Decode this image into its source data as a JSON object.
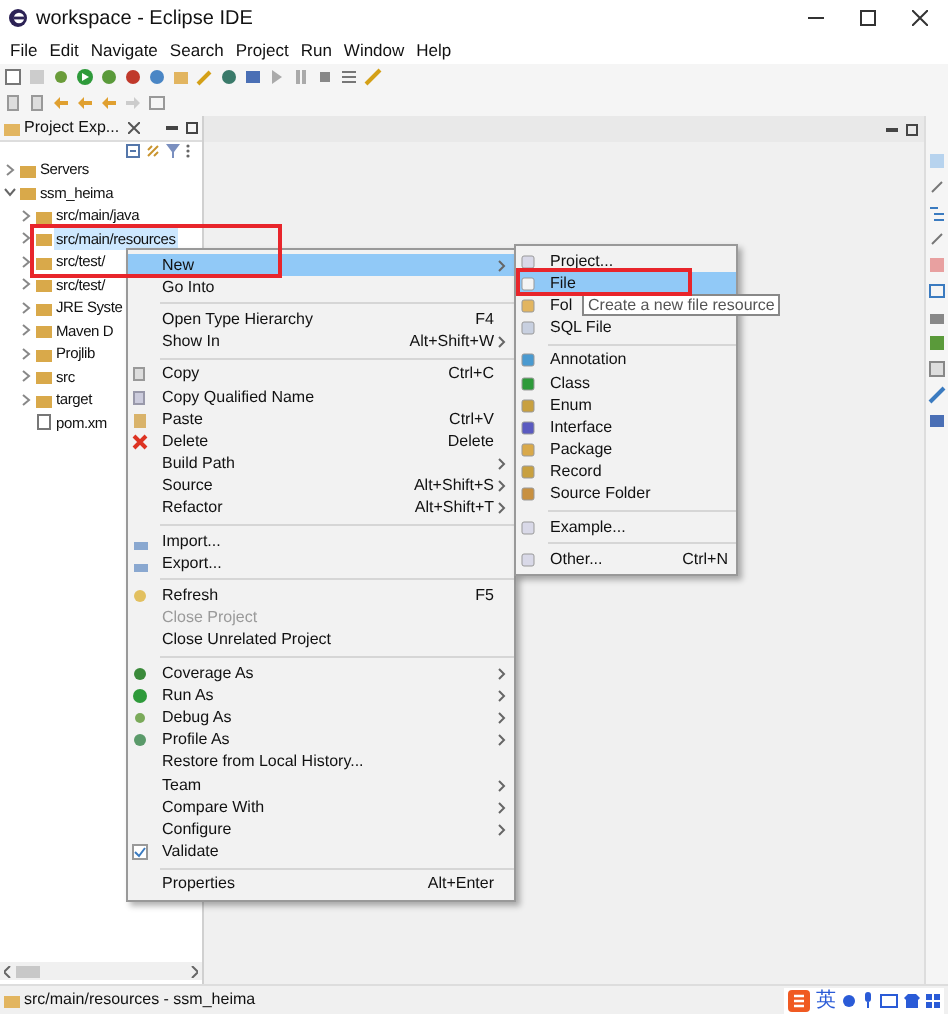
{
  "window": {
    "title": "workspace - Eclipse IDE"
  },
  "menu_bar": [
    "File",
    "Edit",
    "Navigate",
    "Search",
    "Project",
    "Run",
    "Window",
    "Help"
  ],
  "project_explorer": {
    "title": "Project Exp...",
    "tree": [
      {
        "label": "Servers",
        "expanded": false,
        "selected": false
      },
      {
        "label": "ssm_heima",
        "expanded": true,
        "selected": false,
        "children": [
          {
            "label": "src/main/java",
            "expanded": false,
            "selected": false
          },
          {
            "label": "src/main/resources",
            "expanded": false,
            "selected": true
          },
          {
            "label": "src/test/",
            "expanded": false,
            "selected": false
          },
          {
            "label": "src/test/",
            "expanded": false,
            "selected": false
          },
          {
            "label": "JRE Syste",
            "expanded": false,
            "selected": false
          },
          {
            "label": "Maven D",
            "expanded": false,
            "selected": false
          },
          {
            "label": "Projlib",
            "expanded": false,
            "selected": false
          },
          {
            "label": "src",
            "expanded": false,
            "selected": false
          },
          {
            "label": "target",
            "expanded": false,
            "selected": false
          },
          {
            "label": "pom.xm",
            "selected": false
          }
        ]
      }
    ]
  },
  "context_menu": [
    {
      "kind": "item",
      "label": "New",
      "submenu": true,
      "selected": true
    },
    {
      "kind": "item",
      "label": "Go Into",
      "selected": false
    },
    {
      "kind": "separator"
    },
    {
      "kind": "item",
      "label": "Open Type Hierarchy",
      "shortcut": "F4",
      "selected": false
    },
    {
      "kind": "item",
      "label": "Show In",
      "shortcut": "Alt+Shift+W",
      "submenu": true,
      "selected": false
    },
    {
      "kind": "separator"
    },
    {
      "kind": "item",
      "label": "Copy",
      "shortcut": "Ctrl+C",
      "selected": false
    },
    {
      "kind": "item",
      "label": "Copy Qualified Name",
      "selected": false
    },
    {
      "kind": "item",
      "label": "Paste",
      "shortcut": "Ctrl+V",
      "selected": false
    },
    {
      "kind": "item",
      "label": "Delete",
      "shortcut": "Delete",
      "selected": false
    },
    {
      "kind": "item",
      "label": "Build Path",
      "submenu": true,
      "selected": false
    },
    {
      "kind": "item",
      "label": "Source",
      "shortcut": "Alt+Shift+S",
      "submenu": true,
      "selected": false
    },
    {
      "kind": "item",
      "label": "Refactor",
      "shortcut": "Alt+Shift+T",
      "submenu": true,
      "selected": false
    },
    {
      "kind": "separator"
    },
    {
      "kind": "item",
      "label": "Import...",
      "selected": false
    },
    {
      "kind": "item",
      "label": "Export...",
      "selected": false
    },
    {
      "kind": "separator"
    },
    {
      "kind": "item",
      "label": "Refresh",
      "shortcut": "F5",
      "selected": false
    },
    {
      "kind": "item",
      "label": "Close Project",
      "disabled": true,
      "selected": false
    },
    {
      "kind": "item",
      "label": "Close Unrelated Project",
      "selected": false
    },
    {
      "kind": "separator"
    },
    {
      "kind": "item",
      "label": "Coverage As",
      "submenu": true,
      "selected": false
    },
    {
      "kind": "item",
      "label": "Run As",
      "submenu": true,
      "selected": false
    },
    {
      "kind": "item",
      "label": "Debug As",
      "submenu": true,
      "selected": false
    },
    {
      "kind": "item",
      "label": "Profile As",
      "submenu": true,
      "selected": false
    },
    {
      "kind": "item",
      "label": "Restore from Local History...",
      "selected": false
    },
    {
      "kind": "item",
      "label": "Team",
      "submenu": true,
      "selected": false
    },
    {
      "kind": "item",
      "label": "Compare With",
      "submenu": true,
      "selected": false
    },
    {
      "kind": "item",
      "label": "Configure",
      "submenu": true,
      "selected": false
    },
    {
      "kind": "check",
      "label": "Validate",
      "checked": true,
      "selected": false
    },
    {
      "kind": "separator"
    },
    {
      "kind": "item",
      "label": "Properties",
      "shortcut": "Alt+Enter",
      "selected": false
    }
  ],
  "new_submenu": [
    {
      "kind": "item",
      "label": "Project...",
      "selected": false
    },
    {
      "kind": "item",
      "label": "File",
      "selected": true
    },
    {
      "kind": "item",
      "label": "Fol",
      "selected": false
    },
    {
      "kind": "item",
      "label": "SQL File",
      "selected": false
    },
    {
      "kind": "separator"
    },
    {
      "kind": "item",
      "label": "Annotation",
      "selected": false
    },
    {
      "kind": "item",
      "label": "Class",
      "selected": false
    },
    {
      "kind": "item",
      "label": "Enum",
      "selected": false
    },
    {
      "kind": "item",
      "label": "Interface",
      "selected": false
    },
    {
      "kind": "item",
      "label": "Package",
      "selected": false
    },
    {
      "kind": "item",
      "label": "Record",
      "selected": false
    },
    {
      "kind": "item",
      "label": "Source Folder",
      "selected": false
    },
    {
      "kind": "separator"
    },
    {
      "kind": "item",
      "label": "Example...",
      "selected": false
    },
    {
      "kind": "separator"
    },
    {
      "kind": "item",
      "label": "Other...",
      "shortcut": "Ctrl+N",
      "selected": false
    }
  ],
  "tooltip": "Create a new file resource",
  "status_bar": {
    "text": "src/main/resources - ssm_heima"
  },
  "ime_bar": {
    "mode": "英"
  }
}
